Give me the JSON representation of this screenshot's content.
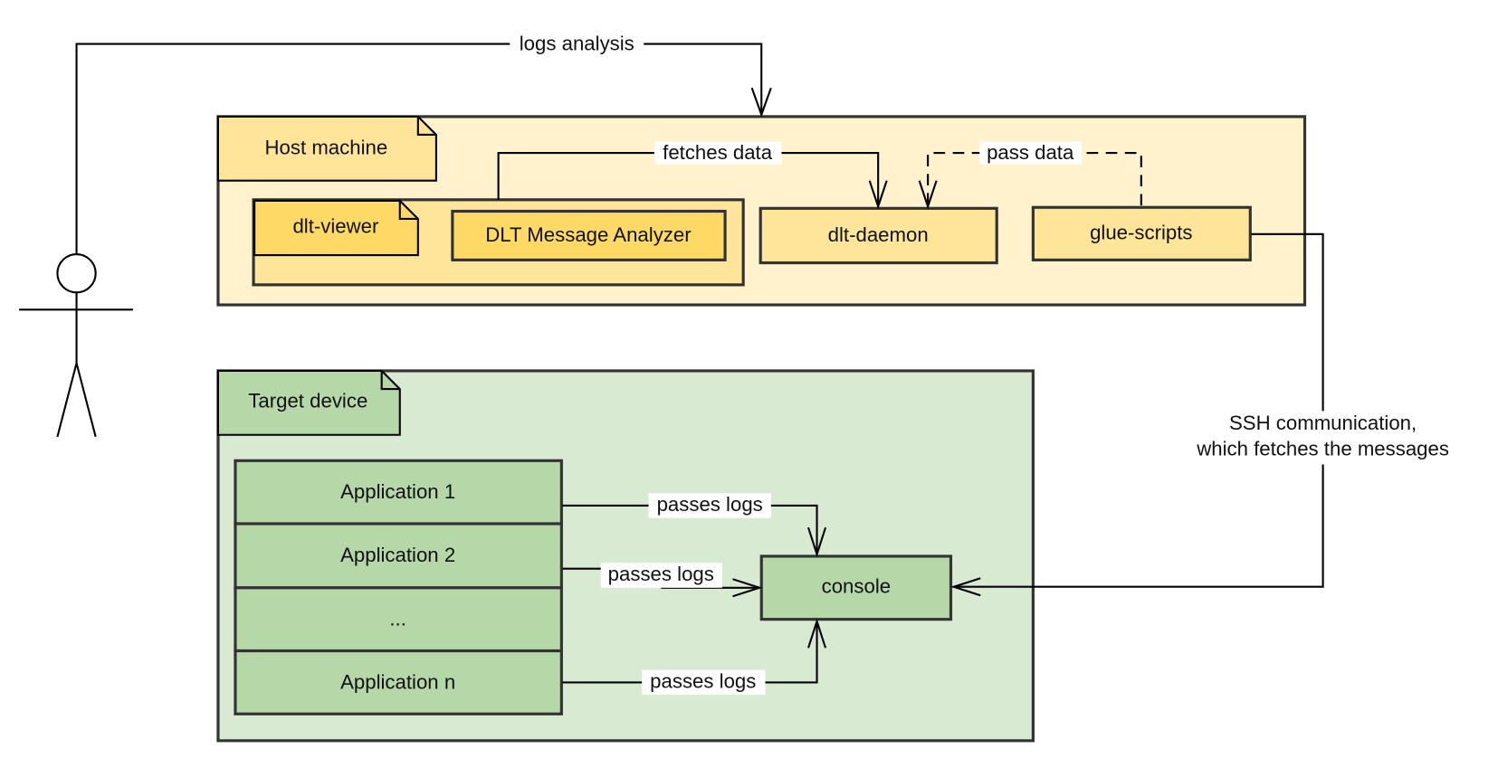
{
  "colors": {
    "host_bg": "#fff2cc",
    "host_tag": "#ffe599",
    "viewer_container": "#ffe599",
    "viewer_tag": "#ffd966",
    "analyzer": "#ffd966",
    "daemon": "#ffe599",
    "glue": "#ffe599",
    "target_bg": "#d9ead3",
    "target_tag": "#b6d7a8",
    "app": "#b6d7a8",
    "console": "#b6d7a8"
  },
  "actor": {
    "icon": "stick-figure-actor-icon"
  },
  "edges": {
    "logs_analysis": "logs analysis",
    "fetches_data": "fetches data",
    "pass_data": "pass data",
    "ssh_line1": "SSH communication,",
    "ssh_line2": "which fetches the messages",
    "passes_logs_1": "passes logs",
    "passes_logs_2": "passes logs",
    "passes_logs_n": "passes logs"
  },
  "host": {
    "title": "Host machine",
    "dlt_viewer": "dlt-viewer",
    "analyzer": "DLT Message Analyzer",
    "daemon": "dlt-daemon",
    "glue": "glue-scripts"
  },
  "target": {
    "title": "Target device",
    "apps": [
      "Application 1",
      "Application 2",
      "...",
      "Application n"
    ],
    "console": "console"
  }
}
